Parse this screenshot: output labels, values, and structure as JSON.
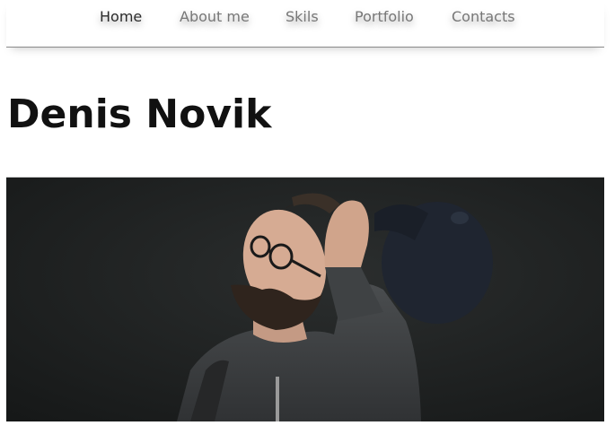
{
  "nav": {
    "items": [
      {
        "label": "Home"
      },
      {
        "label": "About me"
      },
      {
        "label": "Skils"
      },
      {
        "label": "Portfolio"
      },
      {
        "label": "Contacts"
      }
    ]
  },
  "hero": {
    "title": "Denis Novik",
    "photo_icon": "portrait-photo"
  },
  "colors": {
    "background": "#ffffff",
    "nav_text": "#777777",
    "nav_active": "#2b2b2b",
    "title": "#111111",
    "photo_bg": "#1f2121"
  }
}
